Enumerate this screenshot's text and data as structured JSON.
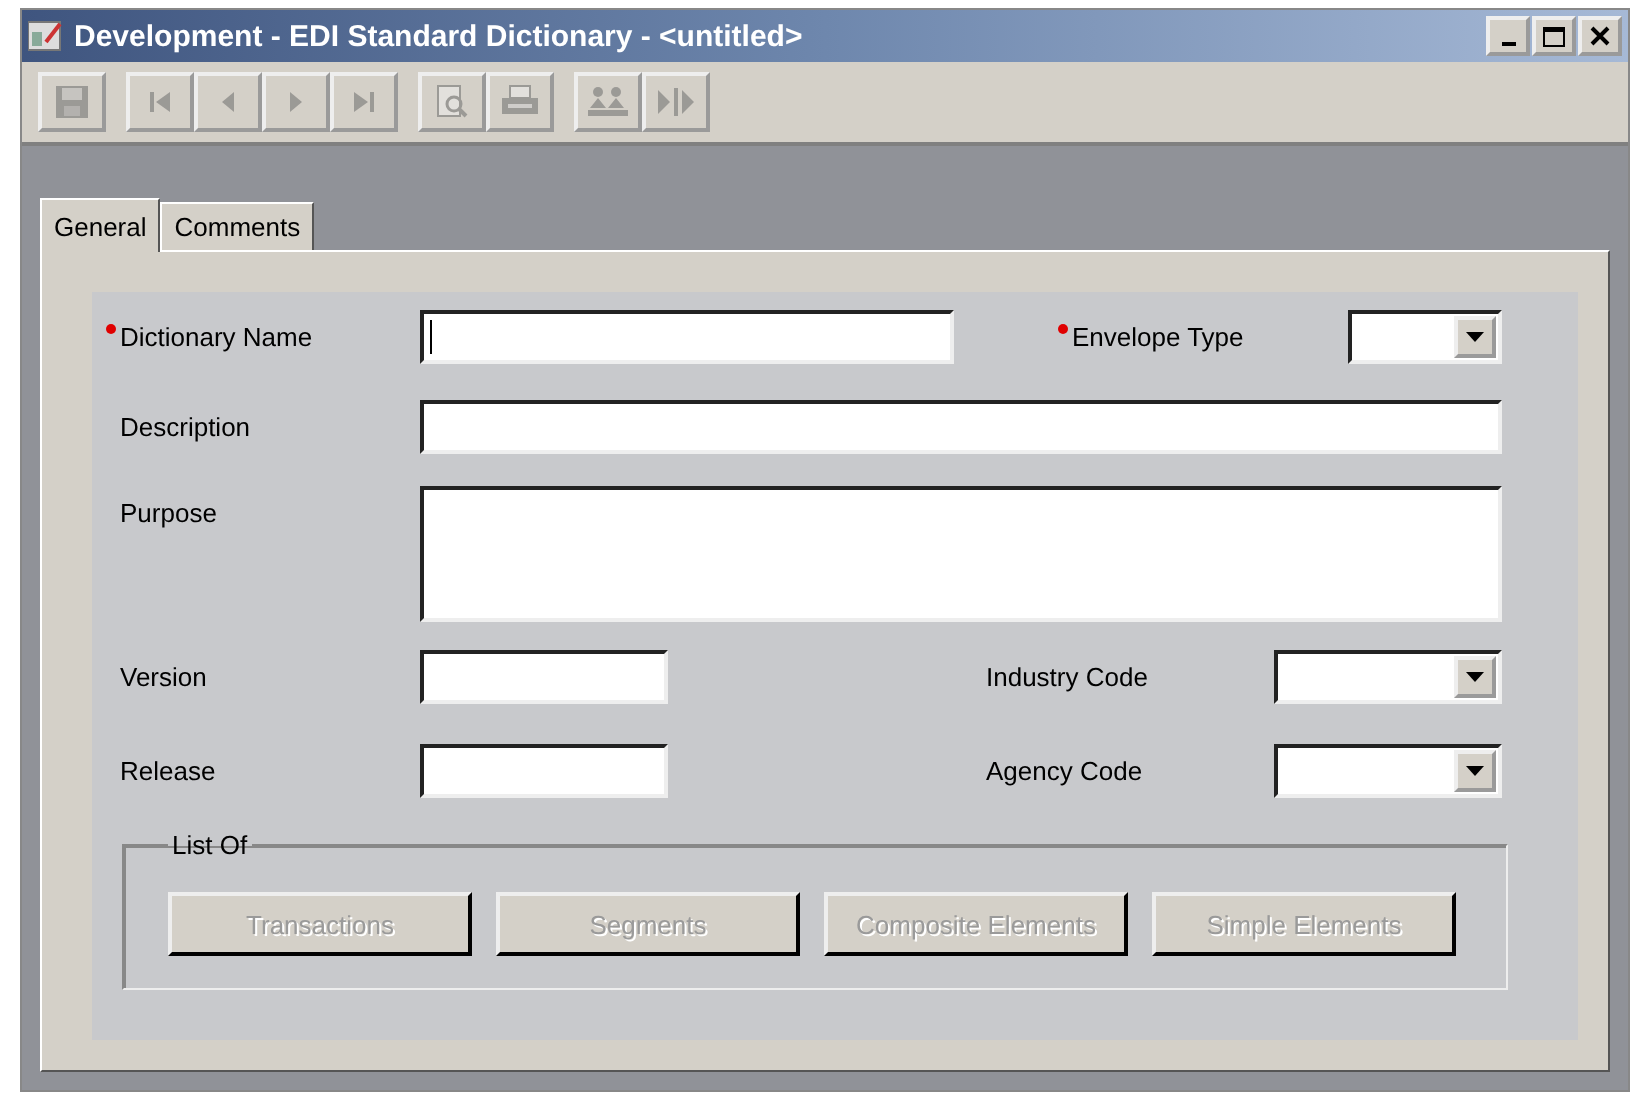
{
  "window": {
    "title": "Development - EDI Standard Dictionary - <untitled>",
    "controls": [
      {
        "kind": "minimize"
      },
      {
        "kind": "maximize"
      },
      {
        "kind": "close"
      }
    ]
  },
  "toolbar": [
    {
      "kind": "save",
      "disabled": true
    },
    {
      "kind": "first",
      "disabled": true
    },
    {
      "kind": "previous",
      "disabled": true
    },
    {
      "kind": "next",
      "disabled": true
    },
    {
      "kind": "last",
      "disabled": true
    },
    {
      "kind": "preview",
      "disabled": true
    },
    {
      "kind": "print",
      "disabled": true
    },
    {
      "kind": "people",
      "disabled": true
    },
    {
      "kind": "split",
      "disabled": true
    }
  ],
  "tabs": [
    {
      "label": "General",
      "selected": true
    },
    {
      "label": "Comments",
      "selected": false
    }
  ],
  "form": {
    "dictionary_name": {
      "label": "Dictionary Name",
      "required": true,
      "focused": true
    },
    "envelope_type": {
      "label": "Envelope Type",
      "required": true
    },
    "description": {
      "label": "Description"
    },
    "purpose": {
      "label": "Purpose"
    },
    "version": {
      "label": "Version"
    },
    "release": {
      "label": "Release"
    },
    "industry_code": {
      "label": "Industry Code"
    },
    "agency_code": {
      "label": "Agency Code"
    }
  },
  "list_of": {
    "title": "List Of",
    "buttons": [
      {
        "label": "Transactions",
        "disabled": true
      },
      {
        "label": "Segments",
        "disabled": true
      },
      {
        "label": "Composite Elements",
        "disabled": true
      },
      {
        "label": "Simple Elements",
        "disabled": true
      }
    ]
  }
}
